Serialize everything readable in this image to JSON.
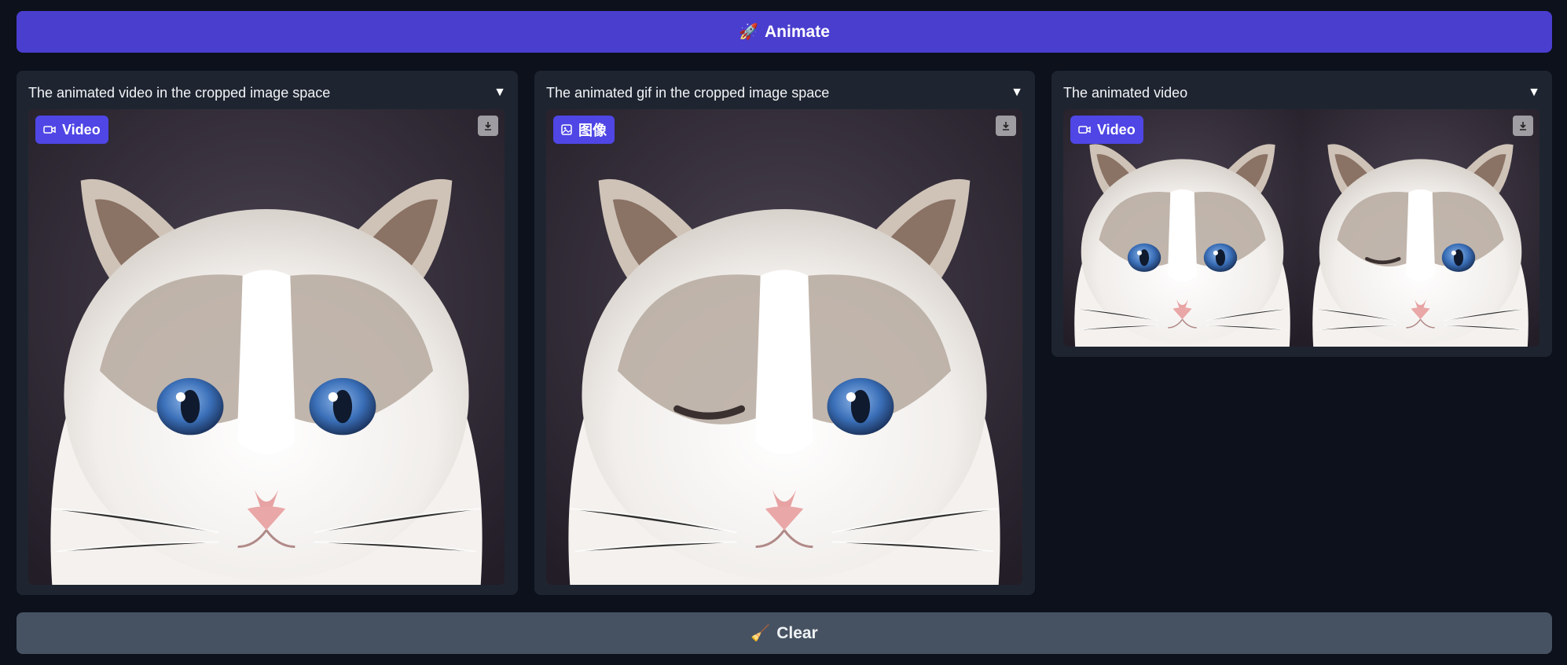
{
  "animate_button": {
    "label": "Animate",
    "icon": "rocket-icon"
  },
  "clear_button": {
    "label": "Clear",
    "icon": "broom-icon"
  },
  "panels": [
    {
      "title": "The animated video in the cropped image space",
      "badge": "Video",
      "badge_icon": "video-camera-icon"
    },
    {
      "title": "The animated gif in the cropped image space",
      "badge": "图像",
      "badge_icon": "image-icon"
    },
    {
      "title": "The animated video",
      "badge": "Video",
      "badge_icon": "video-camera-icon"
    }
  ],
  "colors": {
    "page_bg": "#0c111c",
    "panel_bg": "#1e2530",
    "accent": "#4a3ecf",
    "badge": "#4f46e5",
    "clear_bg": "#465262"
  }
}
